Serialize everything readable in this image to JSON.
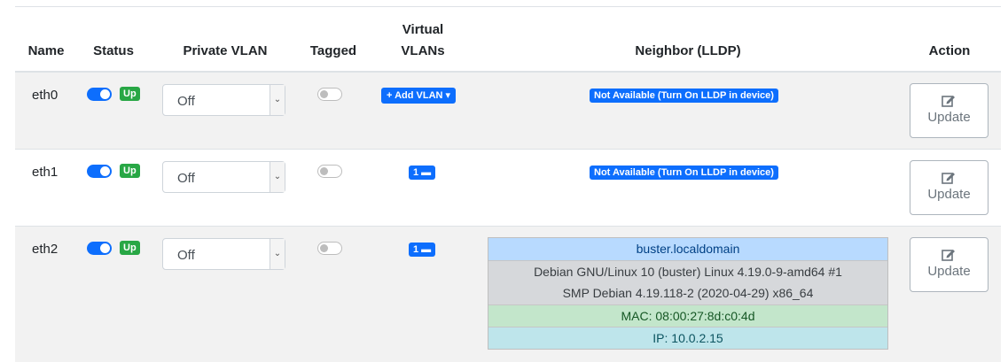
{
  "table": {
    "headers": {
      "name": "Name",
      "status": "Status",
      "private_vlan": "Private VLAN",
      "tagged": "Tagged",
      "virtual_vlans_line1": "Virtual",
      "virtual_vlans_line2": "VLANs",
      "neighbor": "Neighbor (LLDP)",
      "action": "Action"
    },
    "rows": [
      {
        "name": "eth0",
        "status_on": true,
        "status_badge": "Up",
        "private_vlan": "Off",
        "tagged": false,
        "virtual_vlans": "+ Add VLAN ▾",
        "neighbor": "Not Available (Turn On LLDP in device)",
        "action": "Update"
      },
      {
        "name": "eth1",
        "status_on": true,
        "status_badge": "Up",
        "private_vlan": "Off",
        "tagged": false,
        "virtual_vlans": "1 ▬",
        "neighbor": "Not Available (Turn On LLDP in device)",
        "action": "Update"
      },
      {
        "name": "eth2",
        "status_on": true,
        "status_badge": "Up",
        "private_vlan": "Off",
        "tagged": false,
        "virtual_vlans": "1 ▬",
        "neighbor_details": {
          "hostname": "buster.localdomain",
          "description_line1": "Debian GNU/Linux 10 (buster) Linux 4.19.0-9-amd64 #1",
          "description_line2": "SMP Debian 4.19.118-2 (2020-04-29) x86_64",
          "mac": "MAC: 08:00:27:8d:c0:4d",
          "ip": "IP: 10.0.2.15"
        },
        "action": "Update"
      }
    ]
  },
  "icons": {
    "update": "edit-icon",
    "select": "chevron-down-icon"
  },
  "colors": {
    "primary": "#0d6efd",
    "success": "#28a745",
    "stripe": "#f2f2f2"
  }
}
